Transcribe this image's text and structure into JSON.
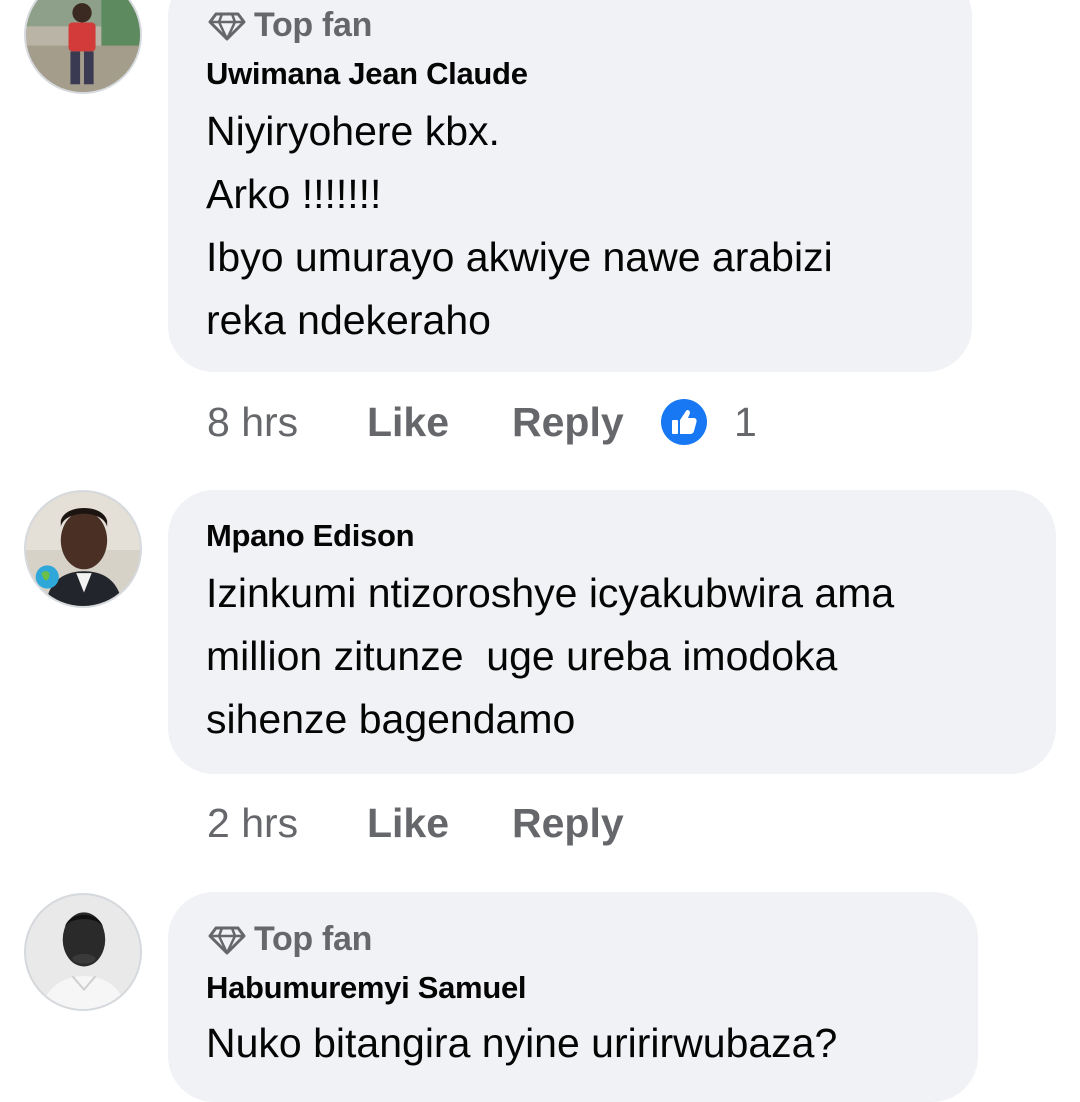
{
  "comments": [
    {
      "top_fan": true,
      "badge_label": "Top fan",
      "author": "Uwimana Jean Claude",
      "lines": [
        "Niyiryohere kbx.",
        "Arko !!!!!!!",
        "Ibyo umurayo akwiye nawe arabizi",
        "reka ndekeraho"
      ],
      "time": "8 hrs",
      "like_label": "Like",
      "reply_label": "Reply",
      "reaction_count": "1",
      "reaction_icon": "like-thumb-icon",
      "accent_color": "#1877f2"
    },
    {
      "top_fan": false,
      "author": "Mpano Edison",
      "lines": [
        "Izinkumi ntizoroshye icyakubwira ama",
        "million zitunze  uge ureba imodoka",
        "sihenze bagendamo"
      ],
      "time": "2 hrs",
      "like_label": "Like",
      "reply_label": "Reply"
    },
    {
      "top_fan": true,
      "badge_label": "Top fan",
      "author": "Habumuremyi Samuel",
      "lines": [
        "Nuko bitangira nyine uririrwubaza?"
      ]
    }
  ]
}
